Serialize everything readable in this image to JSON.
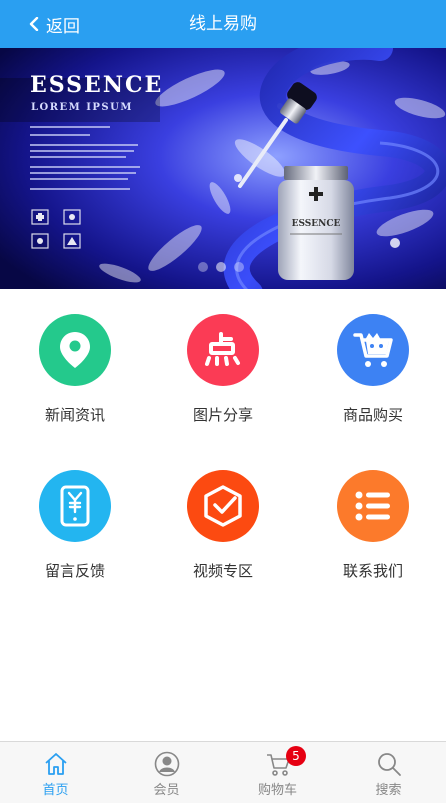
{
  "header": {
    "back_label": "返回",
    "title": "线上易购",
    "background": "#2a9ff1"
  },
  "banner": {
    "brand": "ESSENCE",
    "tagline": "LOREM IPSUM",
    "bottle_label": "ESSENCE",
    "slide_count": 3,
    "active_slide": 1
  },
  "grid": {
    "items": [
      {
        "label": "新闻资讯",
        "icon": "location-pin-icon",
        "color": "#24c98c"
      },
      {
        "label": "图片分享",
        "icon": "dian-character-icon",
        "color": "#fb3b55"
      },
      {
        "label": "商品购买",
        "icon": "shopping-cart-icon",
        "color": "#3d82f3"
      },
      {
        "label": "留言反馈",
        "icon": "yen-phone-icon",
        "color": "#23b5f0"
      },
      {
        "label": "视频专区",
        "icon": "hexagon-check-icon",
        "color": "#fc4a11"
      },
      {
        "label": "联系我们",
        "icon": "list-icon",
        "color": "#fc7a2b"
      }
    ]
  },
  "tabbar": {
    "items": [
      {
        "label": "首页",
        "icon": "home-icon",
        "active": true
      },
      {
        "label": "会员",
        "icon": "member-icon",
        "active": false
      },
      {
        "label": "购物车",
        "icon": "cart-icon",
        "active": false,
        "badge": "5"
      },
      {
        "label": "搜索",
        "icon": "search-icon",
        "active": false
      }
    ],
    "active_color": "#2a9ff1"
  }
}
